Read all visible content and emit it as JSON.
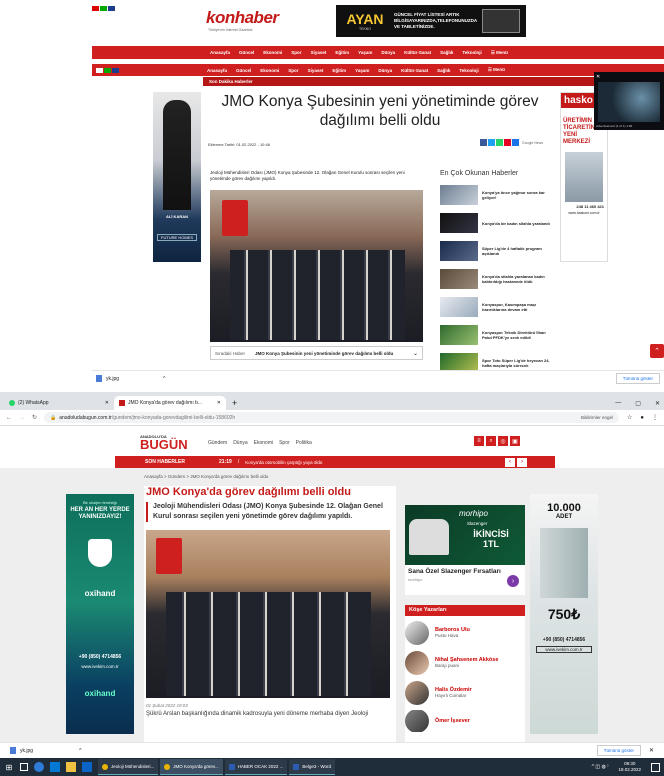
{
  "top": {
    "brand": "konhaber",
    "brand_sub": "Türkiye'nin İnternet Gazetesi",
    "ad_logo": "AYAN",
    "ad_logo_sub": "TEKNO",
    "ad_text": "GÜNCEL FİYAT LİSTESİ ARTIK BİLGİSAYARINIZDA,TELEFONUNUZDA VE TABLETİNİZDE.",
    "nav": [
      "Anasayfa",
      "Güncel",
      "Ekonomi",
      "Spor",
      "Siyaset",
      "Eğitim",
      "Yaşam",
      "Dünya",
      "Kültür-Sanat",
      "Sağlık",
      "Teknoloji",
      "☰ Menü"
    ],
    "breaking": "Son Dakika Haberler",
    "title": "JMO Konya Şubesinin yeni yönetiminde görev dağılımı belli oldu",
    "date": "Eklenme Tarihi: 01.02.2022 - 10:46",
    "share_label": "Google News",
    "lead": "Jeoloji Mühendisleri Odası (JMO) Konya Şubesinde 12. Olağan Genel Kurulu sonrası seçilen yeni yönetimde görev dağılımı yapıldı.",
    "next_label": "Sıradaki Haber",
    "next_title": "JMO Konya Şubesinin yeni yönetiminde görev dağılımı belli oldu",
    "side_title": "En Çok Okunan Haberler",
    "side_items": [
      "Konya'ya önce yağmur sonra kar geliyor!",
      "Konya'da bir kadın silahla yaralandı",
      "Süper Lig'de 4 haftalık program açıklandı",
      "Konya'da silahla yaralanan kadın kaldırıldığı hastanede öldü",
      "Konyaspor, Kasımpaşa maçı hazırlıklarına devam etti",
      "Konyaspor Teknik Direktörü İlhan Palut PFDK'ye sevk edildi",
      "Spor Toto Süper Lig'de heyecan 24. hafta maçlarıyla sürecek"
    ],
    "left_ad_name": "ALİ KARAN",
    "left_ad_logo": "FUTURE HOMES",
    "right_ad_brand": "hasko",
    "right_ad_text": "ÜRETİMIN TİCARETİN YENİ MERKEZİ",
    "right_ad_phone": "248 11 460 421",
    "right_ad_web": "www.haskom.com.tr",
    "video_caption": "Advertisement (1 of 1) 1:00",
    "download_file": "yk.jpg",
    "show_all": "Tümünü göster"
  },
  "browser": {
    "tab1": "(2) WhatsApp",
    "tab2": "JMO Konya'da görev dağılımı b...",
    "url_host": "anadoludabugun.com.tr",
    "url_path": "/gundem/jmo-konyada-gorevdagilimi-belli-oldu-158602h",
    "notif": "Bildirimler engel"
  },
  "bugun": {
    "logo_top": "ANADOLU'DA",
    "logo": "BUGÜN",
    "nav": [
      "Gündem",
      "Dünya",
      "Ekonomi",
      "Spor",
      "Politika"
    ],
    "son_haberler": "SON HABERLER",
    "ticker_time": "21:19",
    "ticker_text": "Konya'da otomobilin çarptığı yaya öldü",
    "crumb": "Anasayfa > Gündem > JMO Konya'da görev dağılımı belli oldu",
    "title": "JMO Konya'da görev dağılımı belli oldu",
    "lead": "Jeoloji Mühendisleri Odası (JMO) Konya Şubesinde 12. Olağan Genel Kurul sonrası seçilen yeni yönetimde görev dağılımı yapıldı.",
    "date": "01 Şubat 2022 19:03",
    "body": "Şükrü Arslan başkanlığında dinamik kadrosuyla yeni döneme merhaba diyen Jeoloji",
    "ad_brand": "morhipo",
    "ad_brand2": "Slazenger",
    "ad_offer": "İKİNCİSİ 1TL",
    "ad_title": "Sana Özel Slazenger Fırsatları",
    "ad_source": "morhipo",
    "kose_title": "Köşe Yazarları",
    "kose": [
      {
        "name": "Barboros Ulu",
        "sub": "Pustu Hava"
      },
      {
        "name": "Nihal Şahsenem Akköse",
        "sub": "Barajı puanı"
      },
      {
        "name": "Halis Özdemir",
        "sub": "Hayırlı Cumalar"
      },
      {
        "name": "Ömer İşsever",
        "sub": ""
      }
    ],
    "left_ad_l1": "Bir oksijen ferahlığı",
    "left_ad_l2": "HER AN HER YERDE YANINIZDAYIZ!",
    "left_ad_brand": "oxihand",
    "left_ad_phone": "+90 (850) 4714856",
    "left_ad_web": "www.ivekim.com.tr",
    "right_ad_count": "10.000",
    "right_ad_count_unit": "ADET",
    "right_ad_price": "750₺",
    "right_ad_phone": "+90 (850) 4714856",
    "right_ad_web": "www.ivekim.com.tr"
  },
  "bottom_bar": {
    "download_file": "yk.jpg",
    "show_all": "Tümünü göster"
  },
  "taskbar": {
    "apps": [
      "Jeoloji Mühendisleri...",
      "JMO Konya'da görev...",
      "HABER OCAK 2022 ...",
      "Belge3 - Word"
    ],
    "time": "08:30",
    "date": "18.02.2022"
  }
}
